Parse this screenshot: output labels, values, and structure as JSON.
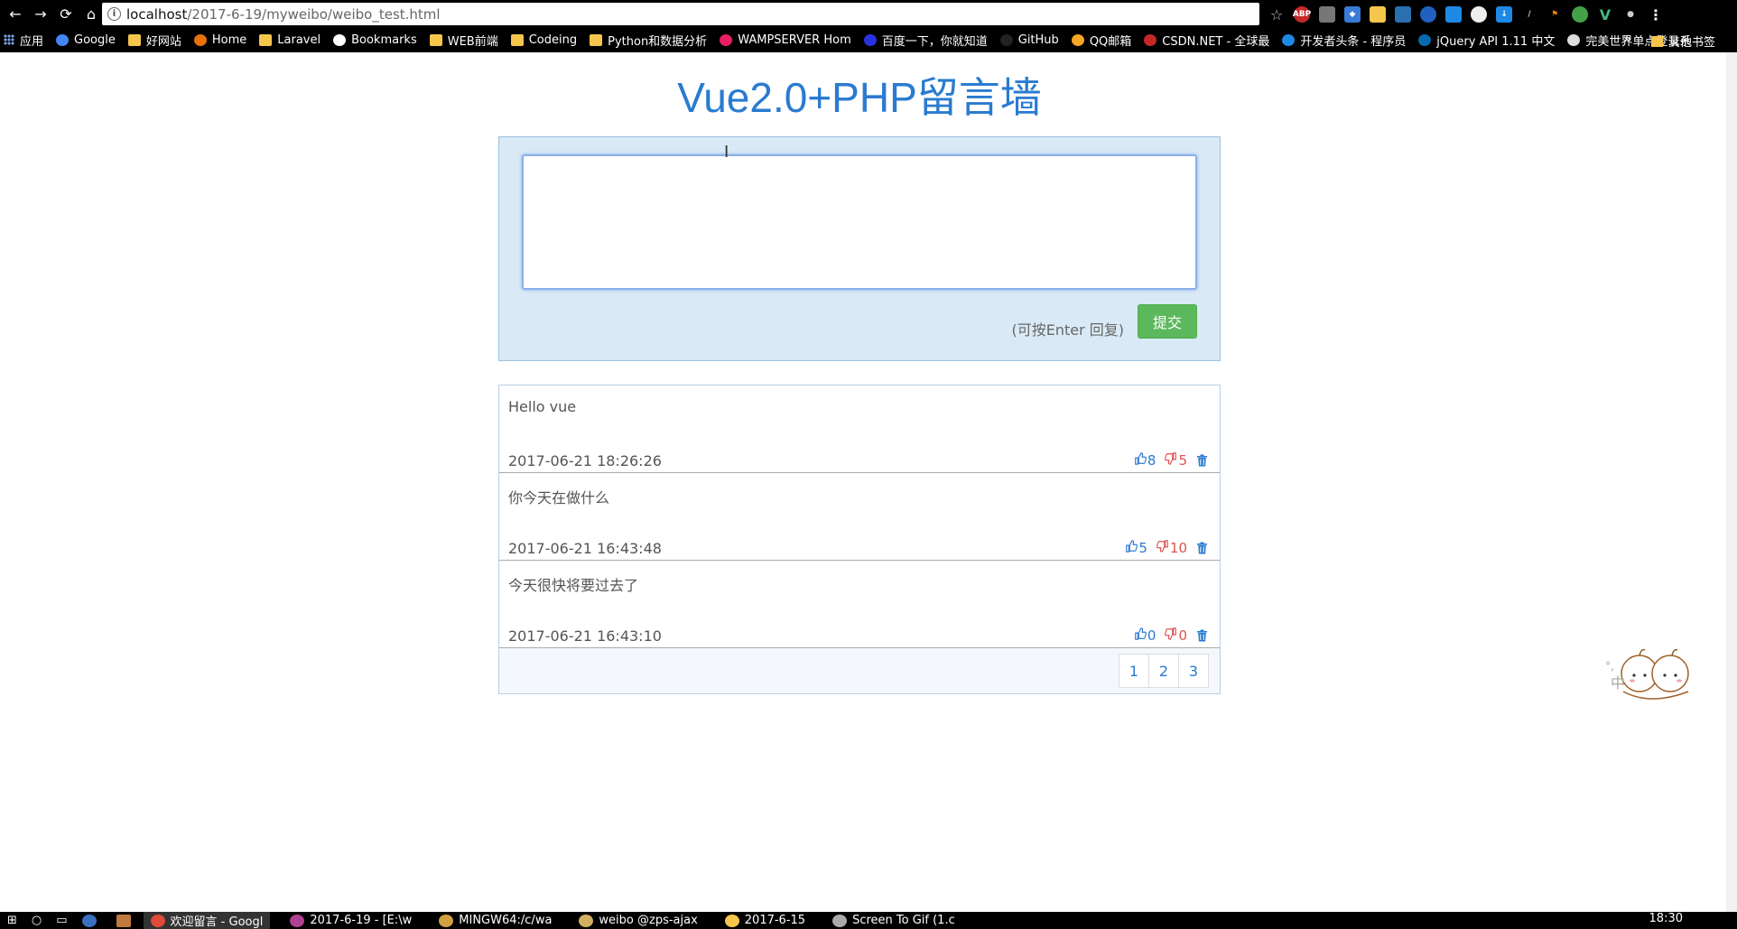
{
  "browser": {
    "url_host": "localhost",
    "url_path": "/2017-6-19/myweibo/weibo_test.html",
    "bookmarks": [
      {
        "label": "应用",
        "kind": "apps"
      },
      {
        "label": "Google",
        "kind": "google"
      },
      {
        "label": "好网站",
        "kind": "folder"
      },
      {
        "label": "Home",
        "kind": "home"
      },
      {
        "label": "Laravel",
        "kind": "folder"
      },
      {
        "label": "Bookmarks",
        "kind": "star"
      },
      {
        "label": "WEB前端",
        "kind": "folder"
      },
      {
        "label": "Codeing",
        "kind": "folder"
      },
      {
        "label": "Python和数据分析",
        "kind": "folder"
      },
      {
        "label": "WAMPSERVER Hom",
        "kind": "wamp"
      },
      {
        "label": "百度一下，你就知道",
        "kind": "baidu"
      },
      {
        "label": "GitHub",
        "kind": "github"
      },
      {
        "label": "QQ邮箱",
        "kind": "qq"
      },
      {
        "label": "CSDN.NET - 全球最",
        "kind": "csdn"
      },
      {
        "label": "开发者头条 - 程序员",
        "kind": "toutiao"
      },
      {
        "label": "jQuery API 1.11 中文",
        "kind": "jquery"
      },
      {
        "label": "完美世界单点登录系",
        "kind": "doc"
      }
    ],
    "bookmarks_more": "»",
    "other_bookmarks": "其他书签"
  },
  "page": {
    "title": "Vue2.0+PHP留言墙",
    "compose": {
      "input_value": "",
      "hint": "(可按Enter 回复)",
      "submit_label": "提交"
    },
    "messages": [
      {
        "content": "Hello vue",
        "time": "2017-06-21 18:26:26",
        "likes": "8",
        "dislikes": "5"
      },
      {
        "content": "你今天在做什么",
        "time": "2017-06-21 16:43:48",
        "likes": "5",
        "dislikes": "10"
      },
      {
        "content": "今天很快将要过去了",
        "time": "2017-06-21 16:43:10",
        "likes": "0",
        "dislikes": "0"
      }
    ],
    "pages": [
      "1",
      "2",
      "3"
    ]
  },
  "mascot": {
    "text": "中"
  },
  "taskbar": {
    "items": [
      {
        "label": "欢迎留言 - Googl",
        "active": true,
        "color": "#e04a3a"
      },
      {
        "label": "2017-6-19 - [E:\\w",
        "active": false,
        "color": "#b04090"
      },
      {
        "label": "MINGW64:/c/wa",
        "active": false,
        "color": "#d0a040"
      },
      {
        "label": "weibo @zps-ajax",
        "active": false,
        "color": "#d0b060"
      },
      {
        "label": "2017-6-15",
        "active": false,
        "color": "#f5c64b"
      },
      {
        "label": "Screen To Gif (1.c",
        "active": false,
        "color": "#aaaaaa"
      }
    ],
    "clock": "18:30"
  },
  "colors": {
    "accent": "#2a7bd0",
    "submit": "#5cb85c",
    "dislike": "#d9534f",
    "compose_bg": "#d9eaf6"
  }
}
